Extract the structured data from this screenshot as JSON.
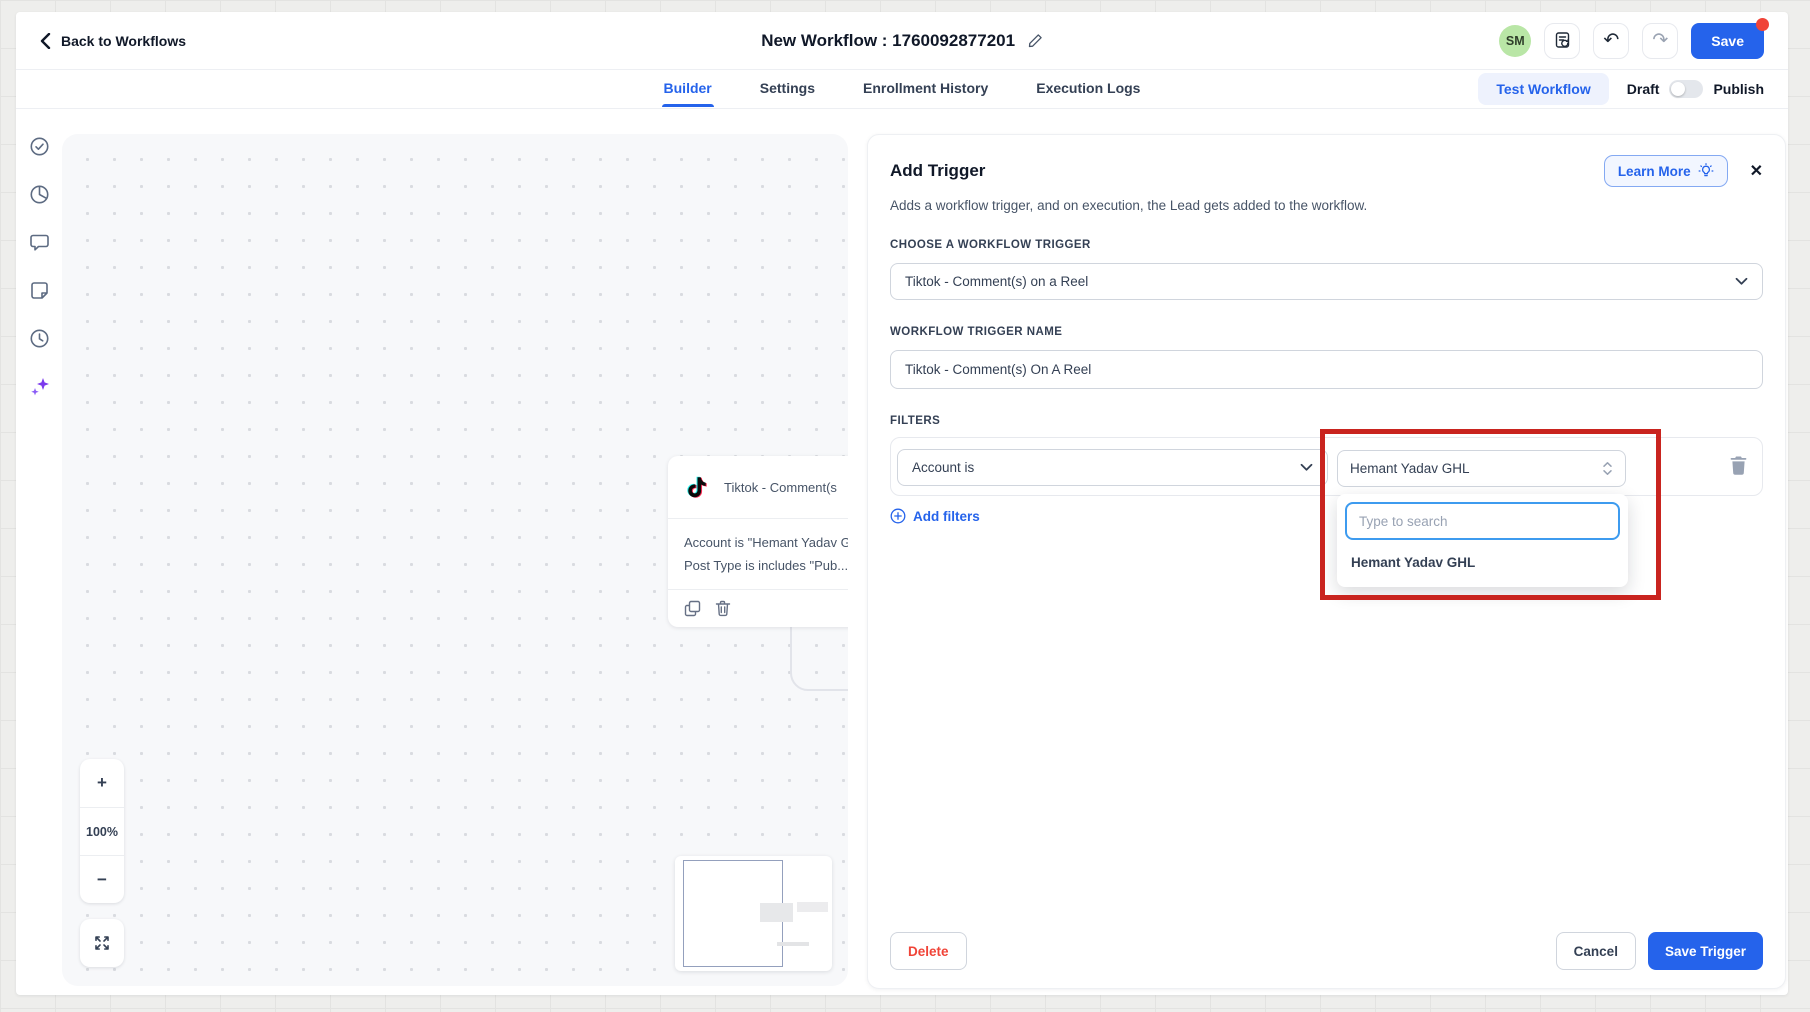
{
  "header": {
    "back_label": "Back to Workflows",
    "title": "New Workflow : 1760092877201",
    "avatar_initials": "SM",
    "save_label": "Save"
  },
  "tabs": {
    "items": [
      "Builder",
      "Settings",
      "Enrollment History",
      "Execution Logs"
    ],
    "active": "Builder"
  },
  "toolbar": {
    "test_workflow_label": "Test Workflow",
    "draft_label": "Draft",
    "publish_label": "Publish",
    "draft_toggle_state": "off"
  },
  "sidebar": {
    "icons": [
      "check-circle",
      "pie-chart",
      "comment",
      "note",
      "history",
      "ai-sparkles"
    ]
  },
  "canvas": {
    "zoom_level": "100%",
    "zoom_in_label": "+",
    "zoom_out_label": "−",
    "node": {
      "title": "Tiktok - Comment(s",
      "filter_line_1": "Account is \"Hemant Yadav G",
      "filter_line_2": "Post Type is includes \"Pub..."
    }
  },
  "panel": {
    "title": "Add Trigger",
    "learn_more_label": "Learn More",
    "close_label": "✕",
    "description": "Adds a workflow trigger, and on execution, the Lead gets added to the workflow.",
    "choose_trigger_label": "CHOOSE A WORKFLOW TRIGGER",
    "trigger_value": "Tiktok - Comment(s) on a Reel",
    "trigger_name_label": "WORKFLOW TRIGGER NAME",
    "trigger_name_value": "Tiktok - Comment(s) On A Reel",
    "filters_label": "FILTERS",
    "filter_field_value": "Account is",
    "filter_account_value": "Hemant Yadav GHL",
    "search_placeholder": "Type to search",
    "dropdown_option": "Hemant Yadav GHL",
    "add_filters_label": "Add filters",
    "delete_label": "Delete",
    "cancel_label": "Cancel",
    "save_trigger_label": "Save Trigger"
  },
  "colors": {
    "primary_blue": "#2563eb",
    "highlight_red": "#c9241f",
    "notification_red": "#f04438",
    "avatar_green": "#b9e6a6",
    "search_focus_blue": "#3d9bef"
  }
}
